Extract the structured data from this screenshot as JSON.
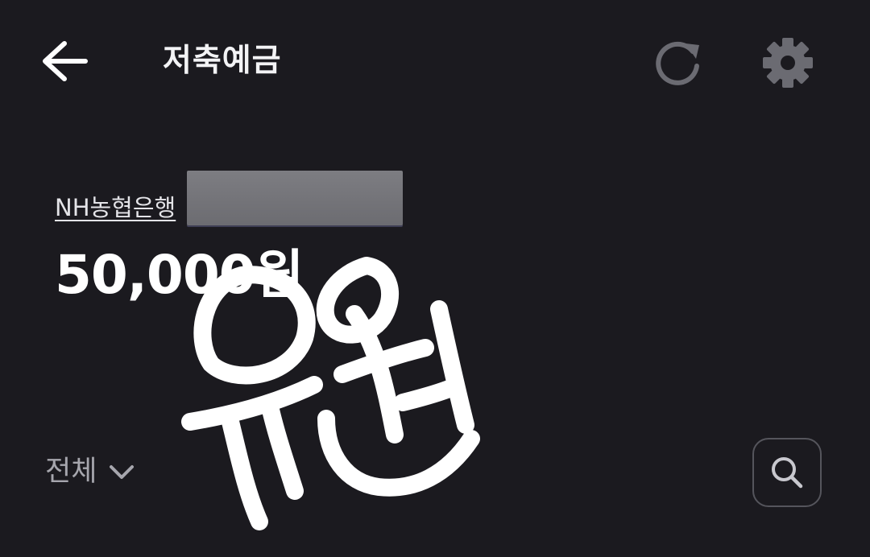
{
  "header": {
    "title": "저축예금",
    "back_icon": "arrow-left-icon",
    "refresh_icon": "refresh-icon",
    "settings_icon": "gear-icon"
  },
  "account": {
    "bank_name": "NH농협은행",
    "balance": "50,000원"
  },
  "filter": {
    "selected_label": "전체",
    "chevron_icon": "chevron-down-icon"
  },
  "search": {
    "icon": "search-icon"
  },
  "colors": {
    "background": "#1b1a1f",
    "icon_muted": "#6b6b72",
    "text_muted": "#a6a6ad",
    "mask": "#747479"
  }
}
